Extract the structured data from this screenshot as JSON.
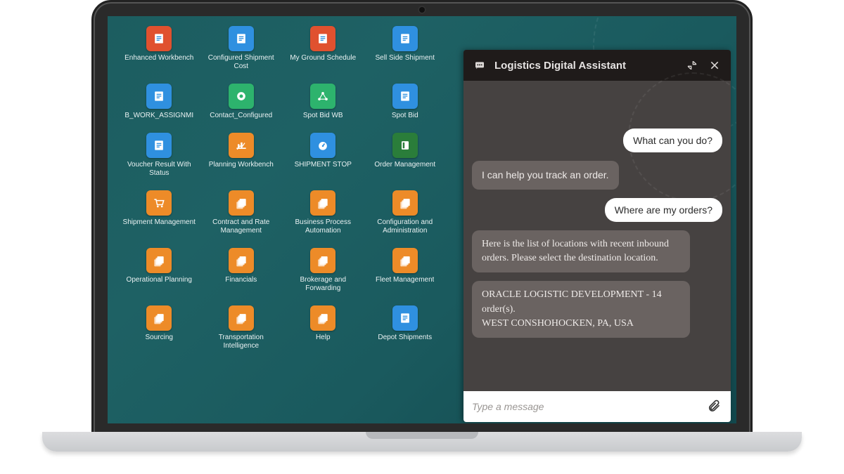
{
  "apps": [
    {
      "label": "Enhanced Workbench",
      "color": "orangeR",
      "icon": "page"
    },
    {
      "label": "Configured Shipment Cost",
      "color": "blue",
      "icon": "page"
    },
    {
      "label": "My Ground Schedule",
      "color": "orangeR",
      "icon": "page"
    },
    {
      "label": "Sell Side Shipment",
      "color": "blue",
      "icon": "page"
    },
    {
      "label": "B_WORK_ASSIGNMI",
      "color": "blue",
      "icon": "page"
    },
    {
      "label": "Contact_Configured",
      "color": "green",
      "icon": "gear"
    },
    {
      "label": "Spot Bid WB",
      "color": "green",
      "icon": "nodes"
    },
    {
      "label": "Spot Bid",
      "color": "blue",
      "icon": "page"
    },
    {
      "label": "Voucher Result With Status",
      "color": "blue",
      "icon": "page"
    },
    {
      "label": "Planning Workbench",
      "color": "orange",
      "icon": "chart"
    },
    {
      "label": "SHIPMENT STOP",
      "color": "blue",
      "icon": "gauge"
    },
    {
      "label": "Order Management",
      "color": "greenD",
      "icon": "ring"
    },
    {
      "label": "Shipment Management",
      "color": "orange",
      "icon": "cart"
    },
    {
      "label": "Contract and Rate Management",
      "color": "orange",
      "icon": "stack"
    },
    {
      "label": "Business Process Automation",
      "color": "orange",
      "icon": "stack"
    },
    {
      "label": "Configuration and Administration",
      "color": "orange",
      "icon": "stack"
    },
    {
      "label": "Operational Planning",
      "color": "orange",
      "icon": "stack"
    },
    {
      "label": "Financials",
      "color": "orange",
      "icon": "stack"
    },
    {
      "label": "Brokerage and Forwarding",
      "color": "orange",
      "icon": "stack"
    },
    {
      "label": "Fleet Management",
      "color": "orange",
      "icon": "stack"
    },
    {
      "label": "Sourcing",
      "color": "orange",
      "icon": "stack"
    },
    {
      "label": "Transportation Intelligence",
      "color": "orange",
      "icon": "stack"
    },
    {
      "label": "Help",
      "color": "orange",
      "icon": "stack"
    },
    {
      "label": "Depot Shipments",
      "color": "blue",
      "icon": "page"
    }
  ],
  "chat": {
    "title": "Logistics Digital Assistant",
    "input_placeholder": "Type a message",
    "messages": [
      {
        "role": "user",
        "text": "What can you do?"
      },
      {
        "role": "bot",
        "text": "I can help you track an order."
      },
      {
        "role": "user",
        "text": "Where are my orders?"
      },
      {
        "role": "bot",
        "text": "Here is the list of locations with recent inbound orders.  Please select the destination location."
      },
      {
        "role": "bot",
        "text": "ORACLE LOGISTIC DEVELOPMENT - 14 order(s).\nWEST CONSHOHOCKEN, PA, USA"
      }
    ]
  }
}
